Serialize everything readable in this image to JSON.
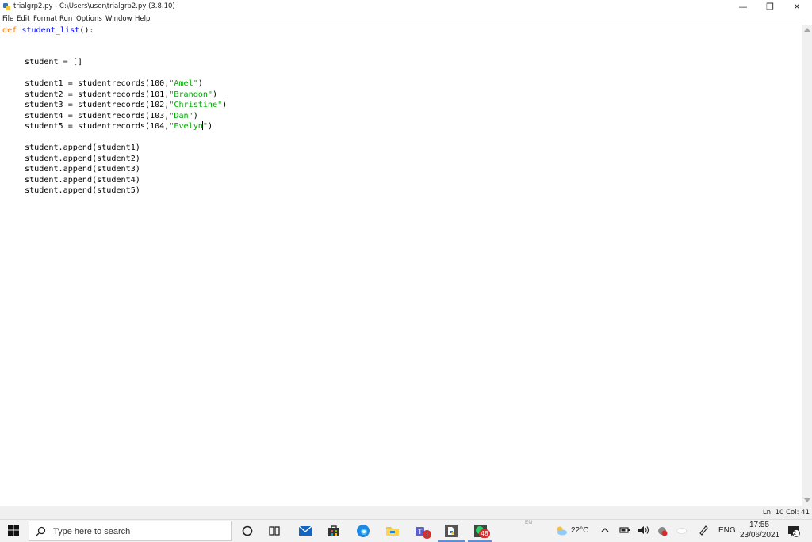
{
  "window": {
    "title": "trialgrp2.py - C:\\Users\\user\\trialgrp2.py (3.8.10)",
    "minimize_glyph": "—",
    "restore_glyph": "❐",
    "close_glyph": "✕"
  },
  "menu": [
    "File",
    "Edit",
    "Format",
    "Run",
    "Options",
    "Window",
    "Help"
  ],
  "code": {
    "line1": {
      "kw": "def",
      "fn": "student_list",
      "rest": "():"
    },
    "line_student": "student = []",
    "records": [
      {
        "pre": "student1 = studentrecords(100,",
        "str": "\"Amel\"",
        "post": ")"
      },
      {
        "pre": "student2 = studentrecords(101,",
        "str": "\"Brandon\"",
        "post": ")"
      },
      {
        "pre": "student3 = studentrecords(102,",
        "str": "\"Christine\"",
        "post": ")"
      },
      {
        "pre": "student4 = studentrecords(103,",
        "str": "\"Dan\"",
        "post": ")"
      },
      {
        "pre": "student5 = studentrecords(104,",
        "str_a": "\"Evelyn",
        "str_b": "\"",
        "post": ")"
      }
    ],
    "appends": [
      "student.append(student1)",
      "student.append(student2)",
      "student.append(student3)",
      "student.append(student4)",
      "student.append(student5)"
    ]
  },
  "status": {
    "position": "Ln: 10  Col: 41"
  },
  "taskbar": {
    "search_placeholder": "Type here to search",
    "teams_badge": "1",
    "whatsapp_badge": "48",
    "weather": "22°C",
    "language": "ENG",
    "ime": "EN",
    "time": "17:55",
    "date": "23/06/2021",
    "notification_count": "2"
  },
  "colors": {
    "keyword": "#ff7700",
    "definition": "#0000ff",
    "string": "#00aa00",
    "accent": "#0078d7"
  }
}
